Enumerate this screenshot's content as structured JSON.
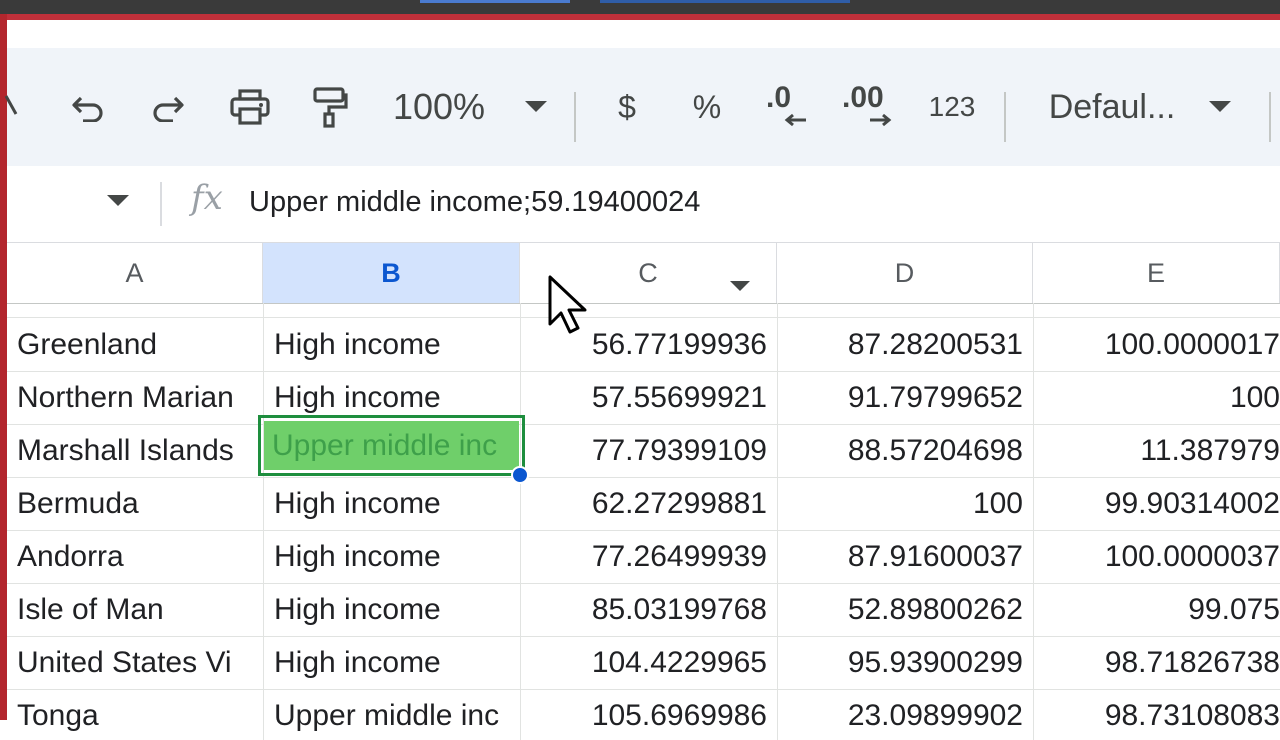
{
  "toolbar": {
    "zoom_label": "100%",
    "currency_label": "$",
    "percent_label": "%",
    "decrease_decimal_label": ".0",
    "increase_decimal_label": ".00",
    "number_format_label": "123",
    "font_label": "Defaul..."
  },
  "formula_bar": {
    "fx_label": "fx",
    "content": "Upper middle income;59.19400024"
  },
  "columns": [
    "A",
    "B",
    "C",
    "D",
    "E"
  ],
  "rows": [
    {
      "a": "Greenland",
      "b": "High income",
      "c": "56.77199936",
      "d": "87.28200531",
      "e": "100.0000017"
    },
    {
      "a": "Northern Marian",
      "b": "High income",
      "c": "57.55699921",
      "d": "91.79799652",
      "e": "100"
    },
    {
      "a": "Marshall Islands",
      "b": "Upper middle inc",
      "c": "77.79399109",
      "d": "88.57204698",
      "e": "11.387979"
    },
    {
      "a": "Bermuda",
      "b": "High income",
      "c": "62.27299881",
      "d": "100",
      "e": "99.90314002"
    },
    {
      "a": "Andorra",
      "b": "High income",
      "c": "77.26499939",
      "d": "87.91600037",
      "e": "100.0000037"
    },
    {
      "a": "Isle of Man",
      "b": "High income",
      "c": "85.03199768",
      "d": "52.89800262",
      "e": "99.075"
    },
    {
      "a": "United States Vi",
      "b": "High income",
      "c": "104.4229965",
      "d": "95.93900299",
      "e": "98.71826738"
    },
    {
      "a": "Tonga",
      "b": "Upper middle inc",
      "c": "105.6969986",
      "d": "23.09899902",
      "e": "98.73108083"
    }
  ],
  "colors": {
    "selection_green": "#1e8e3e",
    "selected_header": "#d3e3fd",
    "toolbar_bg": "#f0f4f9"
  }
}
